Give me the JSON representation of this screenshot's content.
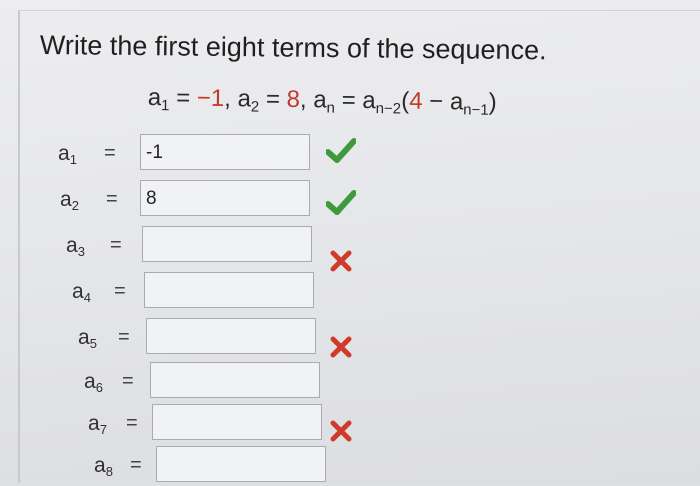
{
  "question": "Write the first eight terms of the sequence.",
  "formula": {
    "a1_label": "a",
    "a1_sub": "1",
    "a1_value": "−1",
    "a2_label": "a",
    "a2_sub": "2",
    "a2_value": "8",
    "an_label": "a",
    "an_sub": "n",
    "rhs_a": "a",
    "rhs_sub": "n−2",
    "rhs_open": "(",
    "rhs_four": "4",
    "rhs_minus": " − ",
    "rhs_a2": "a",
    "rhs_sub2": "n−1",
    "rhs_close": ")"
  },
  "terms": [
    {
      "label": "a",
      "sub": "1",
      "eq": "=",
      "value": "-1",
      "status": "correct"
    },
    {
      "label": "a",
      "sub": "2",
      "eq": "=",
      "value": "8",
      "status": "correct"
    },
    {
      "label": "a",
      "sub": "3",
      "eq": "=",
      "value": "",
      "status": "incorrect"
    },
    {
      "label": "a",
      "sub": "4",
      "eq": "=",
      "value": "",
      "status": "none"
    },
    {
      "label": "a",
      "sub": "5",
      "eq": "=",
      "value": "",
      "status": "incorrect"
    },
    {
      "label": "a",
      "sub": "6",
      "eq": "=",
      "value": "",
      "status": "none"
    },
    {
      "label": "a",
      "sub": "7",
      "eq": "=",
      "value": "",
      "status": "incorrect"
    },
    {
      "label": "a",
      "sub": "8",
      "eq": "=",
      "value": "",
      "status": "none"
    }
  ],
  "colors": {
    "check": "#3f9a3c",
    "cross": "#d03a2a",
    "formula_red": "#c0392b"
  },
  "icons": {
    "correct": "check-icon",
    "incorrect": "cross-icon"
  }
}
